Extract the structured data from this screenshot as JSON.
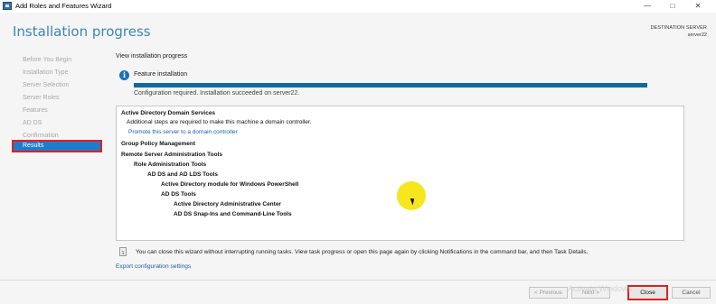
{
  "window": {
    "title": "Add Roles and Features Wizard",
    "min_glyph": "—",
    "max_glyph": "□",
    "close_glyph": "✕"
  },
  "header": {
    "title": "Installation progress",
    "destination_label": "DESTINATION SERVER",
    "destination_server": "server22"
  },
  "sidebar": {
    "items": [
      {
        "label": "Before You Begin"
      },
      {
        "label": "Installation Type"
      },
      {
        "label": "Server Selection"
      },
      {
        "label": "Server Roles"
      },
      {
        "label": "Features"
      },
      {
        "label": "AD DS"
      },
      {
        "label": "Confirmation"
      },
      {
        "label": "Results",
        "active": true
      }
    ]
  },
  "main": {
    "view_title": "View installation progress",
    "feature_label": "Feature installation",
    "progress_fraction": 1.0,
    "status": "Configuration required. Installation succeeded on server22.",
    "results": [
      {
        "text": "Active Directory Domain Services",
        "bold": true,
        "level": 0
      },
      {
        "text": "Additional steps are required to make this machine a domain controller.",
        "bold": false,
        "level": 1
      },
      {
        "text": "Promote this server to a domain controller",
        "link": true,
        "level": 1
      },
      {
        "text": "Group Policy Management",
        "bold": true,
        "level": 0
      },
      {
        "text": "Remote Server Administration Tools",
        "bold": true,
        "level": 0
      },
      {
        "text": "Role Administration Tools",
        "bold": true,
        "level": 1
      },
      {
        "text": "AD DS and AD LDS Tools",
        "bold": true,
        "level": 2
      },
      {
        "text": "Active Directory module for Windows PowerShell",
        "bold": true,
        "level": 3
      },
      {
        "text": "AD DS Tools",
        "bold": true,
        "level": 3
      },
      {
        "text": "Active Directory Administrative Center",
        "bold": true,
        "level": 4
      },
      {
        "text": "AD DS Snap-Ins and Command-Line Tools",
        "bold": true,
        "level": 4
      }
    ],
    "note": "You can close this wizard without interrupting running tasks. View task progress or open this page again by clicking Notifications in the command bar, and then Task Details.",
    "export_link": "Export configuration settings"
  },
  "footer": {
    "previous": "< Previous",
    "next": "Next >",
    "close": "Close",
    "cancel": "Cancel"
  },
  "watermark": "Activate Windows",
  "colors": {
    "accent": "#1f7ccc",
    "title": "#3e86b5",
    "progress": "#11689c",
    "highlight_border": "#e02020"
  }
}
